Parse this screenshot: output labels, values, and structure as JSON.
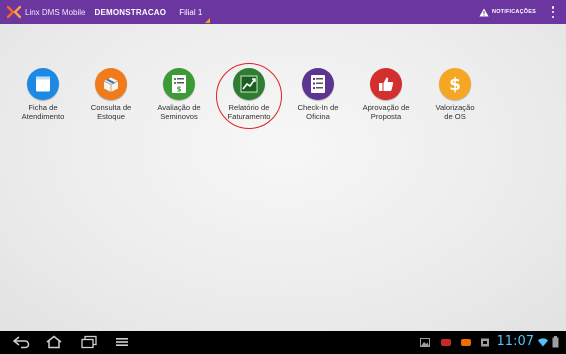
{
  "appbar": {
    "app_title": "Linx DMS Mobile",
    "company": "DEMONSTRACAO",
    "branch": "Filial 1",
    "notifications_label": "NOTIFICAÇÕES",
    "background": "#6b36a0"
  },
  "tiles": [
    {
      "line1": "Ficha de",
      "line2": "Atendimento",
      "icon": "document-icon",
      "color": "#1e88e5"
    },
    {
      "line1": "Consulta de",
      "line2": "Estoque",
      "icon": "box-icon",
      "color": "#ef7b1a"
    },
    {
      "line1": "Avaliação de",
      "line2": "Seminovos",
      "icon": "checklist-dollar-icon",
      "color": "#3d9a36"
    },
    {
      "line1": "Relatório de",
      "line2": "Faturamento",
      "icon": "chart-icon",
      "color": "#2e7d32"
    },
    {
      "line1": "Check-In de",
      "line2": "Oficina",
      "icon": "checklist-icon",
      "color": "#5c3590"
    },
    {
      "line1": "Aprovação de",
      "line2": "Proposta",
      "icon": "thumbs-up-icon",
      "color": "#d32f2f"
    },
    {
      "line1": "Valorização",
      "line2": "de OS",
      "icon": "dollar-icon",
      "color": "#f5a623"
    }
  ],
  "statusbar": {
    "time": "11:07",
    "time_color": "#4fc3f7"
  }
}
